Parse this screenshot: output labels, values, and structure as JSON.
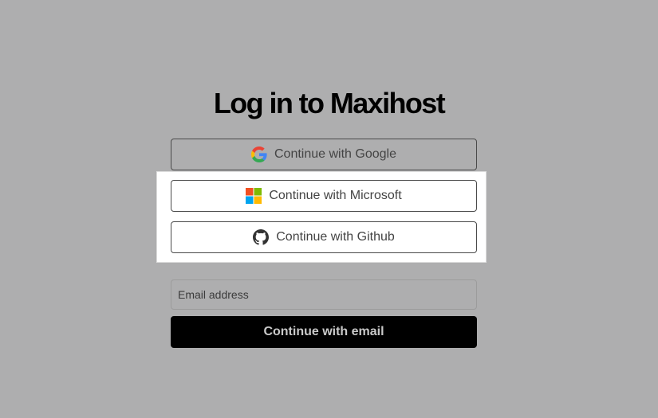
{
  "page": {
    "title": "Log in to Maxihost"
  },
  "oauth": {
    "google": {
      "label": "Continue with Google",
      "icon": "google-icon"
    },
    "microsoft": {
      "label": "Continue with Microsoft",
      "icon": "microsoft-icon"
    },
    "github": {
      "label": "Continue with Github",
      "icon": "github-icon"
    }
  },
  "email_form": {
    "email_placeholder": "Email address",
    "email_value": "",
    "submit_label": "Continue with email"
  },
  "colors": {
    "background": "#aeaeaf",
    "primary_button": "#000000",
    "highlight_panel": "#ffffff",
    "microsoft_red": "#f25022",
    "microsoft_green": "#7fba00",
    "microsoft_blue": "#00a4ef",
    "microsoft_yellow": "#ffb900"
  }
}
